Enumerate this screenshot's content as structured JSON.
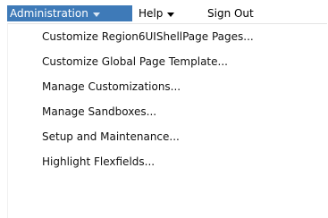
{
  "menubar": {
    "administration": {
      "label": "Administration",
      "arrow": "chevron-down-icon"
    },
    "help": {
      "label": "Help",
      "arrow": "chevron-down-icon"
    },
    "sign_out": {
      "label": "Sign Out"
    }
  },
  "colors": {
    "active_menu_bg": "#3e7ab8",
    "active_menu_text": "#ffffff"
  },
  "dropdown": {
    "items": [
      {
        "label": "Customize Region6UIShellPage Pages..."
      },
      {
        "label": "Customize Global Page Template..."
      },
      {
        "label": "Manage Customizations..."
      },
      {
        "label": "Manage Sandboxes..."
      },
      {
        "label": "Setup and Maintenance..."
      },
      {
        "label": "Highlight Flexfields..."
      }
    ]
  }
}
